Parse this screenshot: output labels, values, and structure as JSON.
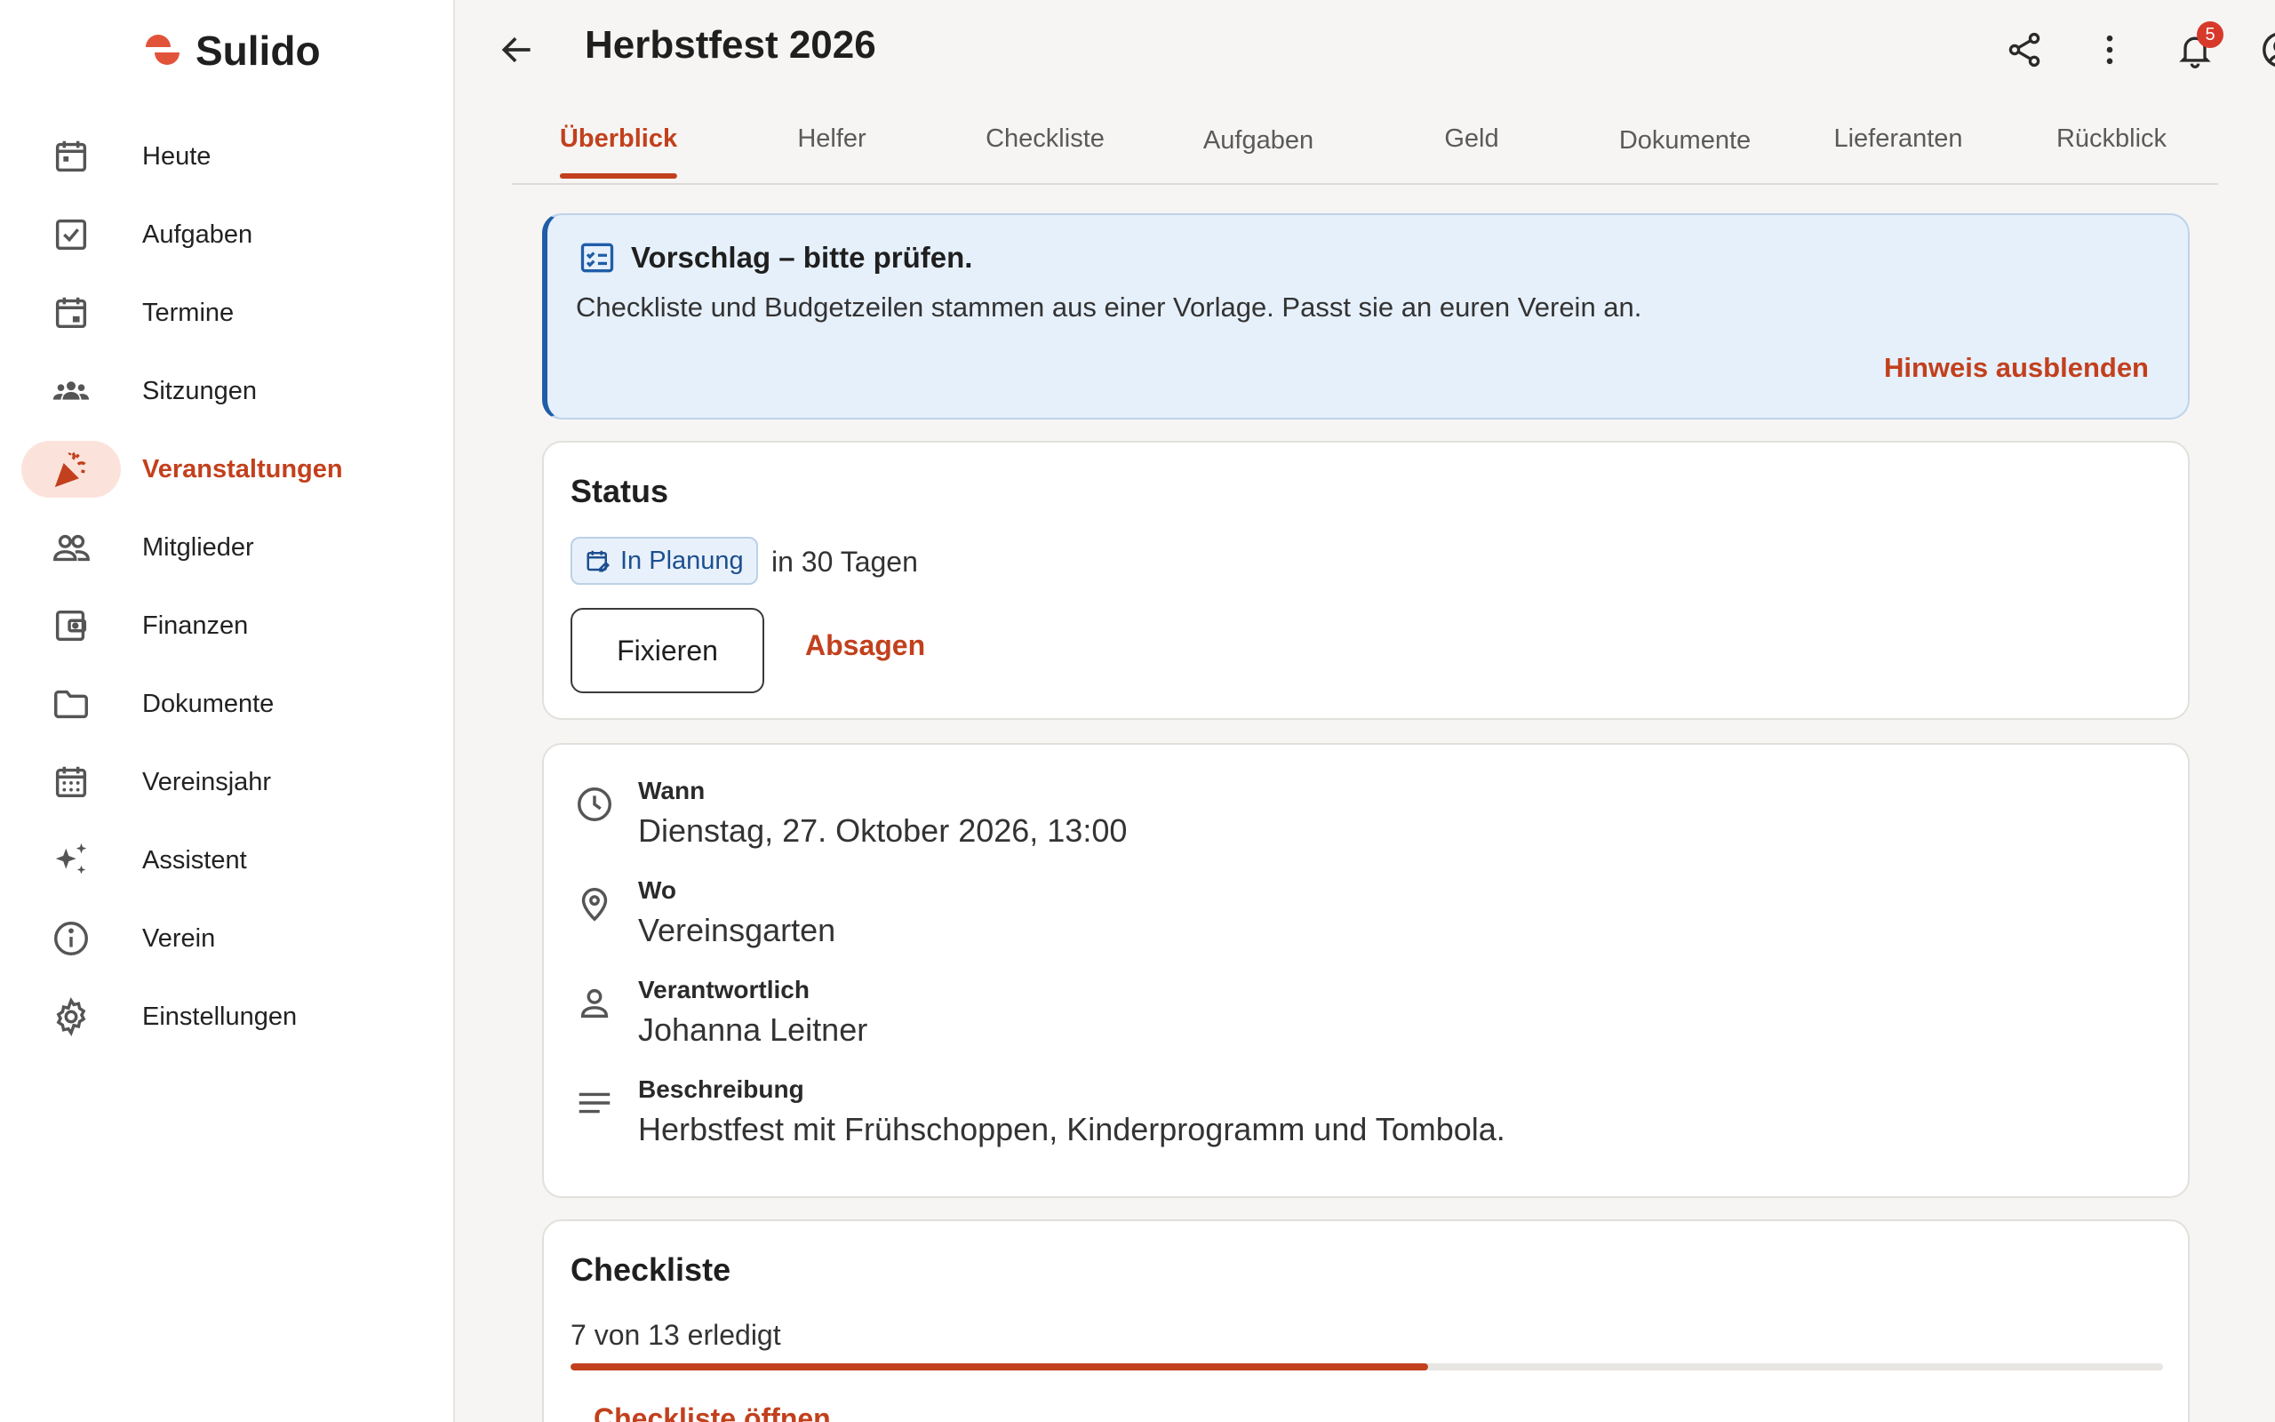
{
  "app": {
    "name": "Sulido",
    "accent": "#c2401d"
  },
  "sidebar": {
    "items": [
      {
        "label": "Heute",
        "icon": "calendar-today-icon"
      },
      {
        "label": "Aufgaben",
        "icon": "checkbox-icon"
      },
      {
        "label": "Termine",
        "icon": "calendar-event-icon"
      },
      {
        "label": "Sitzungen",
        "icon": "groups-icon"
      },
      {
        "label": "Veranstaltungen",
        "icon": "party-popper-icon",
        "active": true
      },
      {
        "label": "Mitglieder",
        "icon": "people-icon"
      },
      {
        "label": "Finanzen",
        "icon": "wallet-icon"
      },
      {
        "label": "Dokumente",
        "icon": "folder-icon"
      },
      {
        "label": "Vereinsjahr",
        "icon": "calendar-month-icon"
      },
      {
        "label": "Assistent",
        "icon": "sparkle-icon"
      },
      {
        "label": "Verein",
        "icon": "info-icon"
      },
      {
        "label": "Einstellungen",
        "icon": "gear-icon"
      }
    ]
  },
  "header": {
    "title": "Herbstfest 2026",
    "notifications_count": "5"
  },
  "tabs": [
    {
      "label": "Überblick",
      "active": true
    },
    {
      "label": "Helfer"
    },
    {
      "label": "Checkliste"
    },
    {
      "label": "Aufgaben"
    },
    {
      "label": "Geld"
    },
    {
      "label": "Dokumente"
    },
    {
      "label": "Lieferanten"
    },
    {
      "label": "Rückblick"
    }
  ],
  "notice": {
    "title": "Vorschlag – bitte prüfen.",
    "text": "Checkliste und Budgetzeilen stammen aus einer Vorlage. Passt sie an euren Verein an.",
    "dismiss": "Hinweis ausblenden"
  },
  "status": {
    "heading": "Status",
    "chip": "In Planung",
    "due": "in 30 Tagen",
    "primary_button": "Fixieren",
    "secondary_button": "Absagen"
  },
  "details": {
    "when_label": "Wann",
    "when_value": "Dienstag, 27. Oktober 2026, 13:00",
    "where_label": "Wo",
    "where_value": "Vereinsgarten",
    "owner_label": "Verantwortlich",
    "owner_value": "Johanna Leitner",
    "desc_label": "Beschreibung",
    "desc_value": "Herbstfest mit Frühschoppen, Kinderprogramm und Tombola."
  },
  "checklist": {
    "heading": "Checkliste",
    "progress_text": "7 von 13 erledigt",
    "done": 7,
    "total": 13,
    "link": "Checkliste öffnen"
  }
}
